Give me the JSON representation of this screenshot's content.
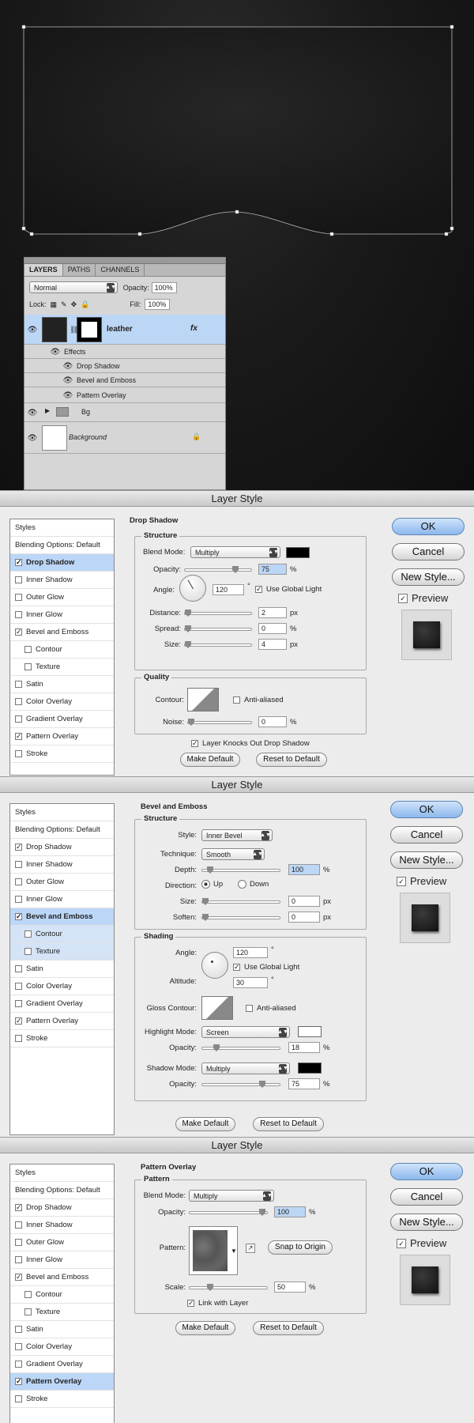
{
  "layers_panel": {
    "tabs": [
      "LAYERS",
      "PATHS",
      "CHANNELS"
    ],
    "blend_mode": "Normal",
    "opacity_label": "Opacity:",
    "opacity_value": "100%",
    "lock_label": "Lock:",
    "fill_label": "Fill:",
    "fill_value": "100%",
    "layers": [
      {
        "name": "leather",
        "fx": "fx"
      },
      {
        "name": "Bg"
      },
      {
        "name": "Background"
      }
    ],
    "effects_label": "Effects",
    "effects": [
      "Drop Shadow",
      "Bevel and Emboss",
      "Pattern Overlay"
    ]
  },
  "dialog_title": "Layer Style",
  "styles_list": {
    "header": "Styles",
    "blending": "Blending Options: Default",
    "items": [
      "Drop Shadow",
      "Inner Shadow",
      "Outer Glow",
      "Inner Glow",
      "Bevel and Emboss",
      "Contour",
      "Texture",
      "Satin",
      "Color Overlay",
      "Gradient Overlay",
      "Pattern Overlay",
      "Stroke"
    ],
    "checked": [
      "Drop Shadow",
      "Bevel and Emboss",
      "Pattern Overlay"
    ]
  },
  "buttons": {
    "ok": "OK",
    "cancel": "Cancel",
    "new_style": "New Style...",
    "preview": "Preview",
    "make_default": "Make Default",
    "reset": "Reset to Default"
  },
  "drop_shadow": {
    "title": "Drop Shadow",
    "structure": "Structure",
    "blend_label": "Blend Mode:",
    "blend": "Multiply",
    "color": "#000000",
    "opacity_label": "Opacity:",
    "opacity": "75",
    "opacity_pct": 0.75,
    "angle_label": "Angle:",
    "angle": "120",
    "global_light": "Use Global Light",
    "distance_label": "Distance:",
    "distance": "2",
    "spread_label": "Spread:",
    "spread": "0",
    "size_label": "Size:",
    "size": "4",
    "quality": "Quality",
    "contour_label": "Contour:",
    "anti_aliased": "Anti-aliased",
    "noise_label": "Noise:",
    "noise": "0",
    "knocks_out": "Layer Knocks Out Drop Shadow"
  },
  "bevel": {
    "title": "Bevel and Emboss",
    "structure": "Structure",
    "style_label": "Style:",
    "style": "Inner Bevel",
    "technique_label": "Technique:",
    "technique": "Smooth",
    "depth_label": "Depth:",
    "depth": "100",
    "direction_label": "Direction:",
    "up": "Up",
    "down": "Down",
    "size_label": "Size:",
    "size": "0",
    "soften_label": "Soften:",
    "soften": "0",
    "shading": "Shading",
    "angle_label": "Angle:",
    "angle": "120",
    "altitude_label": "Altitude:",
    "altitude": "30",
    "global_light": "Use Global Light",
    "gloss_label": "Gloss Contour:",
    "anti_aliased": "Anti-aliased",
    "highlight_label": "Highlight Mode:",
    "highlight": "Screen",
    "highlight_color": "#ffffff",
    "hl_opacity_label": "Opacity:",
    "hl_opacity": "18",
    "shadow_label": "Shadow Mode:",
    "shadow": "Multiply",
    "shadow_color": "#000000",
    "sh_opacity_label": "Opacity:",
    "sh_opacity": "75"
  },
  "pattern": {
    "title": "Pattern Overlay",
    "group": "Pattern",
    "blend_label": "Blend Mode:",
    "blend": "Multiply",
    "opacity_label": "Opacity:",
    "opacity": "100",
    "pattern_label": "Pattern:",
    "snap": "Snap to Origin",
    "scale_label": "Scale:",
    "scale": "50",
    "link": "Link with Layer"
  },
  "units": {
    "pct": "%",
    "px": "px",
    "deg": "°"
  }
}
